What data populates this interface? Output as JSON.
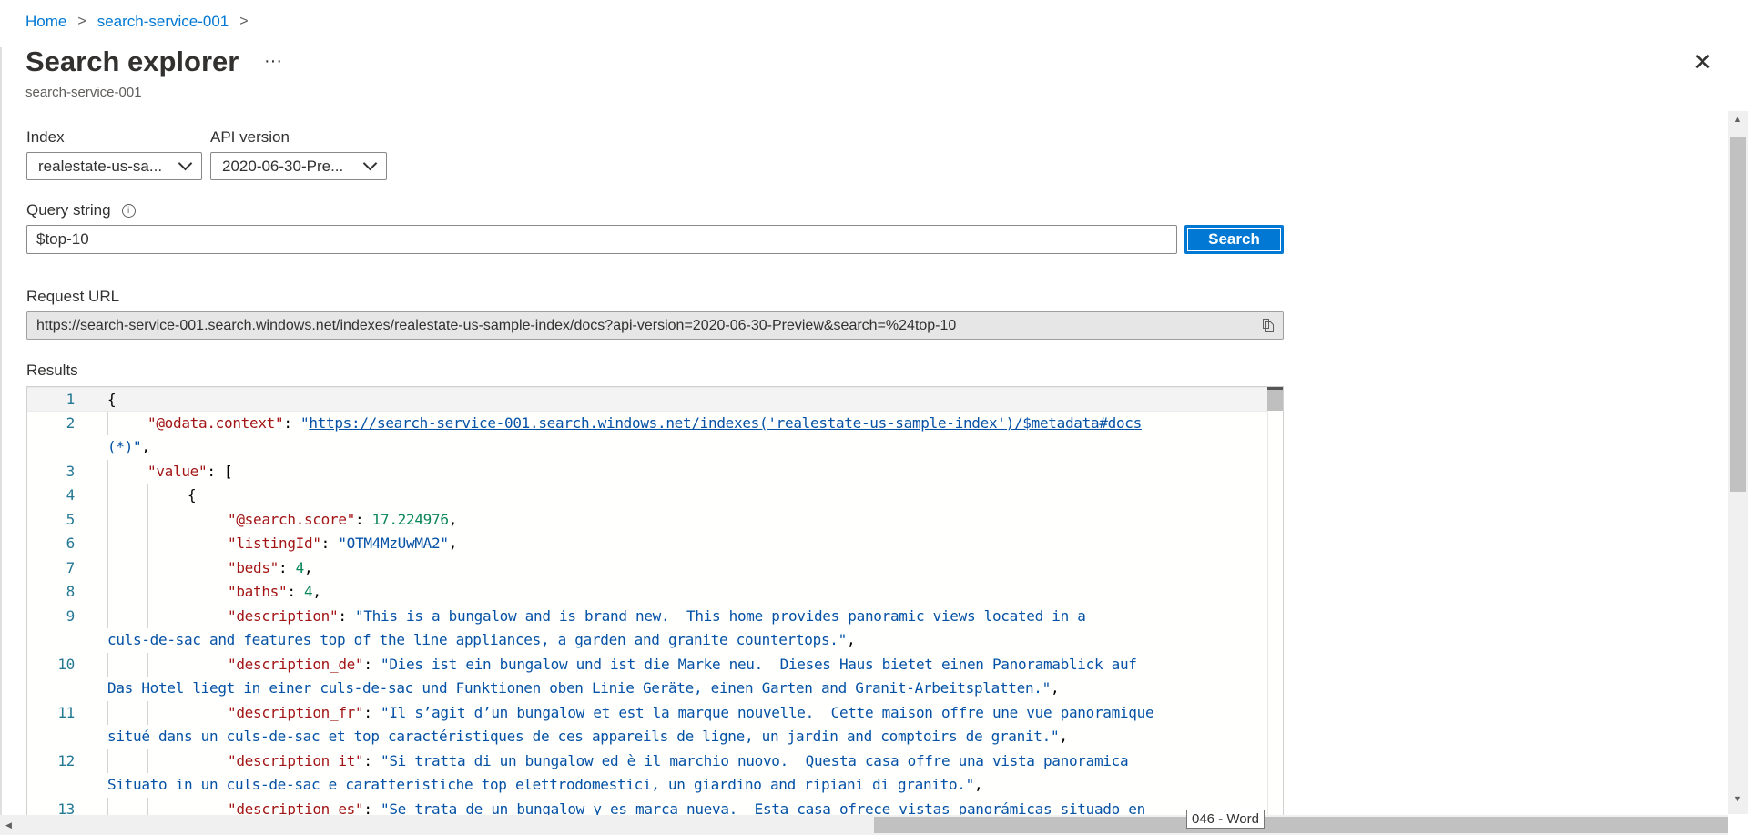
{
  "breadcrumb": {
    "items": [
      "Home",
      "search-service-001"
    ]
  },
  "header": {
    "title": "Search explorer",
    "more": "···",
    "subtitle": "search-service-001",
    "close": "✕"
  },
  "index": {
    "label": "Index",
    "value": "realestate-us-sa..."
  },
  "api_version": {
    "label": "API version",
    "value": "2020-06-30-Pre..."
  },
  "query": {
    "label": "Query string",
    "value": "$top-10",
    "search_label": "Search"
  },
  "request_url": {
    "label": "Request URL",
    "value": "https://search-service-001.search.windows.net/indexes/realestate-us-sample-index/docs?api-version=2020-06-30-Preview&search=%24top-10"
  },
  "results": {
    "label": "Results",
    "rows": [
      {
        "num": "1",
        "indent": 0,
        "seg": [
          [
            "p",
            "{"
          ]
        ]
      },
      {
        "num": "2",
        "indent": 1,
        "seg": [
          [
            "k",
            "\"@odata.context\""
          ],
          [
            "p",
            ": "
          ],
          [
            "s",
            "\""
          ],
          [
            "u",
            "https://search-service-001.search.windows.net/indexes('realestate-us-sample-index')/$metadata#docs"
          ]
        ]
      },
      {
        "num": "",
        "indent": 0,
        "seg": [
          [
            "u",
            "(*)"
          ],
          [
            "s",
            "\""
          ],
          [
            "p",
            ","
          ]
        ]
      },
      {
        "num": "3",
        "indent": 1,
        "seg": [
          [
            "k",
            "\"value\""
          ],
          [
            "p",
            ": ["
          ]
        ]
      },
      {
        "num": "4",
        "indent": 2,
        "seg": [
          [
            "p",
            "{"
          ]
        ]
      },
      {
        "num": "5",
        "indent": 3,
        "seg": [
          [
            "k",
            "\"@search.score\""
          ],
          [
            "p",
            ": "
          ],
          [
            "n",
            "17.224976"
          ],
          [
            "p",
            ","
          ]
        ]
      },
      {
        "num": "6",
        "indent": 3,
        "seg": [
          [
            "k",
            "\"listingId\""
          ],
          [
            "p",
            ": "
          ],
          [
            "s",
            "\"OTM4MzUwMA2\""
          ],
          [
            "p",
            ","
          ]
        ]
      },
      {
        "num": "7",
        "indent": 3,
        "seg": [
          [
            "k",
            "\"beds\""
          ],
          [
            "p",
            ": "
          ],
          [
            "n",
            "4"
          ],
          [
            "p",
            ","
          ]
        ]
      },
      {
        "num": "8",
        "indent": 3,
        "seg": [
          [
            "k",
            "\"baths\""
          ],
          [
            "p",
            ": "
          ],
          [
            "n",
            "4"
          ],
          [
            "p",
            ","
          ]
        ]
      },
      {
        "num": "9",
        "indent": 3,
        "seg": [
          [
            "k",
            "\"description\""
          ],
          [
            "p",
            ": "
          ],
          [
            "s",
            "\"This is a bungalow and is brand new.  This home provides panoramic views located in a"
          ]
        ]
      },
      {
        "num": "",
        "indent": 0,
        "seg": [
          [
            "s",
            "culs-de-sac and features top of the line appliances, a garden and granite countertops.\""
          ],
          [
            "p",
            ","
          ]
        ]
      },
      {
        "num": "10",
        "indent": 3,
        "seg": [
          [
            "k",
            "\"description_de\""
          ],
          [
            "p",
            ": "
          ],
          [
            "s",
            "\"Dies ist ein bungalow und ist die Marke neu.  Dieses Haus bietet einen Panoramablick auf"
          ]
        ]
      },
      {
        "num": "",
        "indent": 0,
        "seg": [
          [
            "s",
            "Das Hotel liegt in einer culs-de-sac und Funktionen oben Linie Geräte, einen Garten and Granit-Arbeitsplatten.\""
          ],
          [
            "p",
            ","
          ]
        ]
      },
      {
        "num": "11",
        "indent": 3,
        "seg": [
          [
            "k",
            "\"description_fr\""
          ],
          [
            "p",
            ": "
          ],
          [
            "s",
            "\"Il s’agit d’un bungalow et est la marque nouvelle.  Cette maison offre une vue panoramique"
          ]
        ]
      },
      {
        "num": "",
        "indent": 0,
        "seg": [
          [
            "s",
            "situé dans un culs-de-sac et top caractéristiques de ces appareils de ligne, un jardin and comptoirs de granit.\""
          ],
          [
            "p",
            ","
          ]
        ]
      },
      {
        "num": "12",
        "indent": 3,
        "seg": [
          [
            "k",
            "\"description_it\""
          ],
          [
            "p",
            ": "
          ],
          [
            "s",
            "\"Si tratta di un bungalow ed è il marchio nuovo.  Questa casa offre una vista panoramica"
          ]
        ]
      },
      {
        "num": "",
        "indent": 0,
        "seg": [
          [
            "s",
            "Situato in un culs-de-sac e caratteristiche top elettrodomestici, un giardino and ripiani di granito.\""
          ],
          [
            "p",
            ","
          ]
        ]
      },
      {
        "num": "13",
        "indent": 3,
        "seg": [
          [
            "k",
            "\"description_es\""
          ],
          [
            "p",
            ": "
          ],
          [
            "s",
            "\"Se trata de un bungalow y es marca nueva.  Esta casa ofrece vistas panorámicas situado en"
          ]
        ]
      }
    ]
  },
  "tooltip": "046 - Word"
}
